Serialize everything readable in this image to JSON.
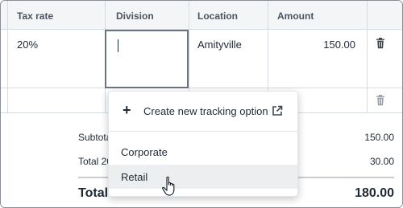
{
  "columns": {
    "tax_rate": "Tax rate",
    "division": "Division",
    "location": "Location",
    "amount": "Amount"
  },
  "line_item": {
    "tax_rate": "20%",
    "division": "",
    "location": "Amityville",
    "amount": "150.00"
  },
  "summary": {
    "subtotal_label": "Subtota",
    "subtotal_value": "150.00",
    "tax_label": "Total 20",
    "tax_value": "30.00",
    "total_label": "Total",
    "total_value": "180.00"
  },
  "dropdown": {
    "create_label": "Create new tracking option",
    "options": [
      {
        "label": "Corporate",
        "highlighted": false
      },
      {
        "label": "Retail",
        "highlighted": true
      }
    ]
  },
  "icons": {
    "delete": "trash-icon",
    "create": "plus-icon",
    "external": "external-link-icon",
    "cursor": "hand-pointer-icon"
  },
  "colors": {
    "header_bg": "#f4f5f7",
    "border": "#d6dbe0",
    "focus_border": "#6b7480",
    "hover_bg": "#eceef0"
  }
}
